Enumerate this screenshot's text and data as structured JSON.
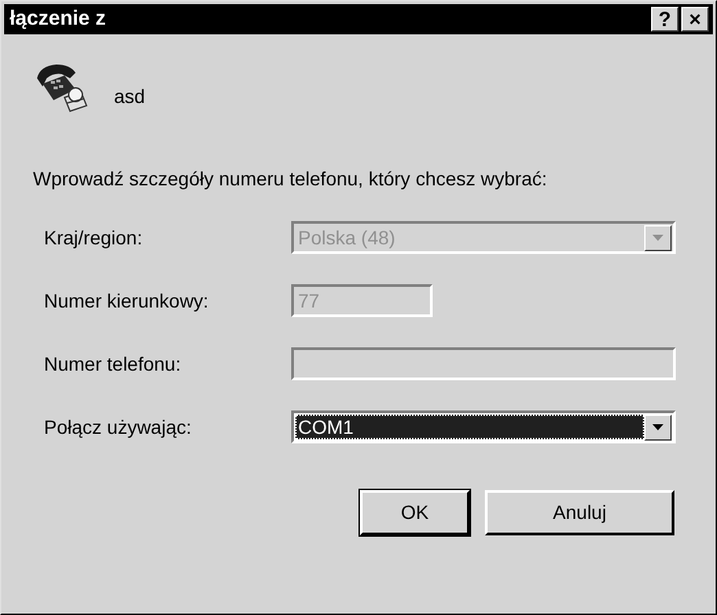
{
  "window": {
    "title": "łączenie z",
    "buttons": [
      {
        "kind": "help",
        "label": "?"
      },
      {
        "kind": "close",
        "label": "×"
      }
    ]
  },
  "entry": {
    "name": "asd"
  },
  "instruction": "Wprowadź szczegóły numeru telefonu, który chcesz wybrać:",
  "fields": [
    {
      "label": "Kraj/region:",
      "kind": "select",
      "value": "Polska (48)",
      "disabled": true,
      "selected": false
    },
    {
      "label": "Numer kierunkowy:",
      "kind": "code",
      "value": "77",
      "disabled": true,
      "selected": false
    },
    {
      "label": "Numer telefonu:",
      "kind": "text",
      "disabled": true,
      "selected": false
    },
    {
      "label": "Połącz używając:",
      "kind": "select",
      "value": "COM1",
      "disabled": false,
      "selected": true
    }
  ],
  "buttons": [
    {
      "label": "OK",
      "default": true
    },
    {
      "label": "Anuluj",
      "default": false
    }
  ]
}
